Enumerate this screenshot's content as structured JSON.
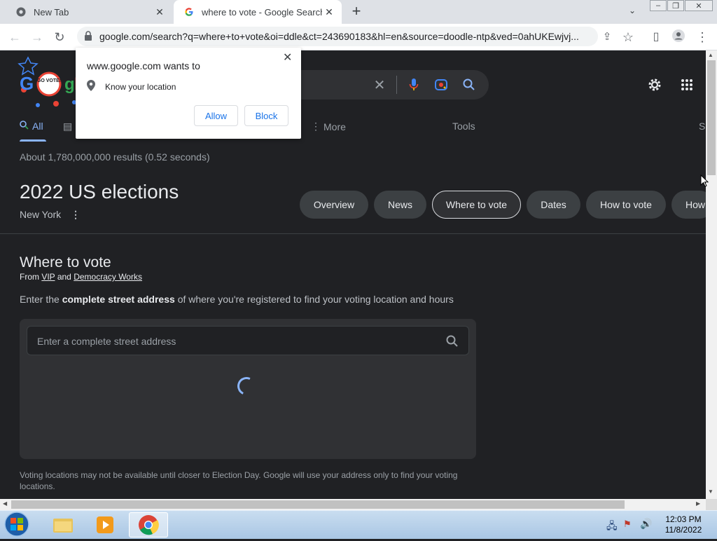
{
  "browser": {
    "tabs": [
      {
        "title": "New Tab",
        "active": false
      },
      {
        "title": "where to vote - Google Search",
        "active": true
      }
    ],
    "url": "google.com/search?q=where+to+vote&oi=ddle&ct=243690183&hl=en&source=doodle-ntp&ved=0ahUKEwjvj..."
  },
  "permission_popup": {
    "title": "www.google.com wants to",
    "item": "Know your location",
    "allow": "Allow",
    "block": "Block"
  },
  "logo": {
    "badge_text": "GO VOTE!"
  },
  "nav": {
    "tabs": [
      "All",
      "More",
      "Tools"
    ],
    "cut_tab": "S"
  },
  "result_stats": "About 1,780,000,000 results (0.52 seconds)",
  "elections": {
    "title": "2022 US elections",
    "location": "New York",
    "chips": [
      "Overview",
      "News",
      "Where to vote",
      "Dates",
      "How to vote",
      "How"
    ],
    "selected_chip": "Where to vote"
  },
  "where_to_vote": {
    "title": "Where to vote",
    "from_prefix": "From",
    "source1": "VIP",
    "and": "and",
    "source2": "Democracy Works",
    "instr_pre": "Enter the",
    "instr_bold": "complete street address",
    "instr_post": "of where you're registered to find your voting location and hours",
    "input_placeholder": "Enter a complete street address",
    "disclaimer": "Voting locations may not be available until closer to Election Day. Google will use your address only to find your voting locations."
  },
  "taskbar": {
    "time": "12:03 PM",
    "date": "11/8/2022"
  },
  "colors": {
    "accent": "#8ab4f8",
    "page_bg": "#202124",
    "chip_bg": "#3c4043"
  }
}
